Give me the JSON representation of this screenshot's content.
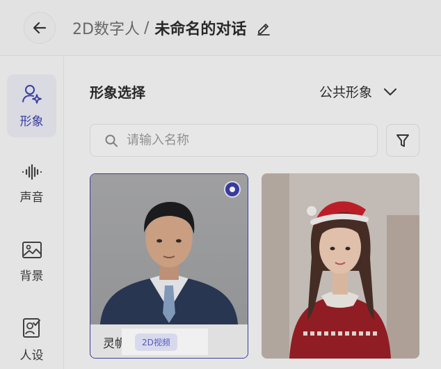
{
  "header": {
    "crumb_root": "2D数字人",
    "crumb_sep": "/",
    "crumb_current": "未命名的对话"
  },
  "sidebar": {
    "items": [
      {
        "label": "形象",
        "icon": "avatar-sparkle-icon",
        "active": true
      },
      {
        "label": "声音",
        "icon": "waveform-icon",
        "active": false
      },
      {
        "label": "背景",
        "icon": "image-icon",
        "active": false
      },
      {
        "label": "人设",
        "icon": "persona-card-icon",
        "active": false
      }
    ]
  },
  "main": {
    "title": "形象选择",
    "scope_selected": "公共形象",
    "search": {
      "placeholder": "请输入名称",
      "value": ""
    }
  },
  "cards": [
    {
      "name": "灵帆",
      "tag": "2D视频",
      "selected": true
    },
    {
      "name": "",
      "tag": "",
      "selected": false
    }
  ],
  "colors": {
    "accent": "#3f42ab",
    "tag_bg": "#e6e7fb",
    "tag_text": "#5a5fc7"
  }
}
